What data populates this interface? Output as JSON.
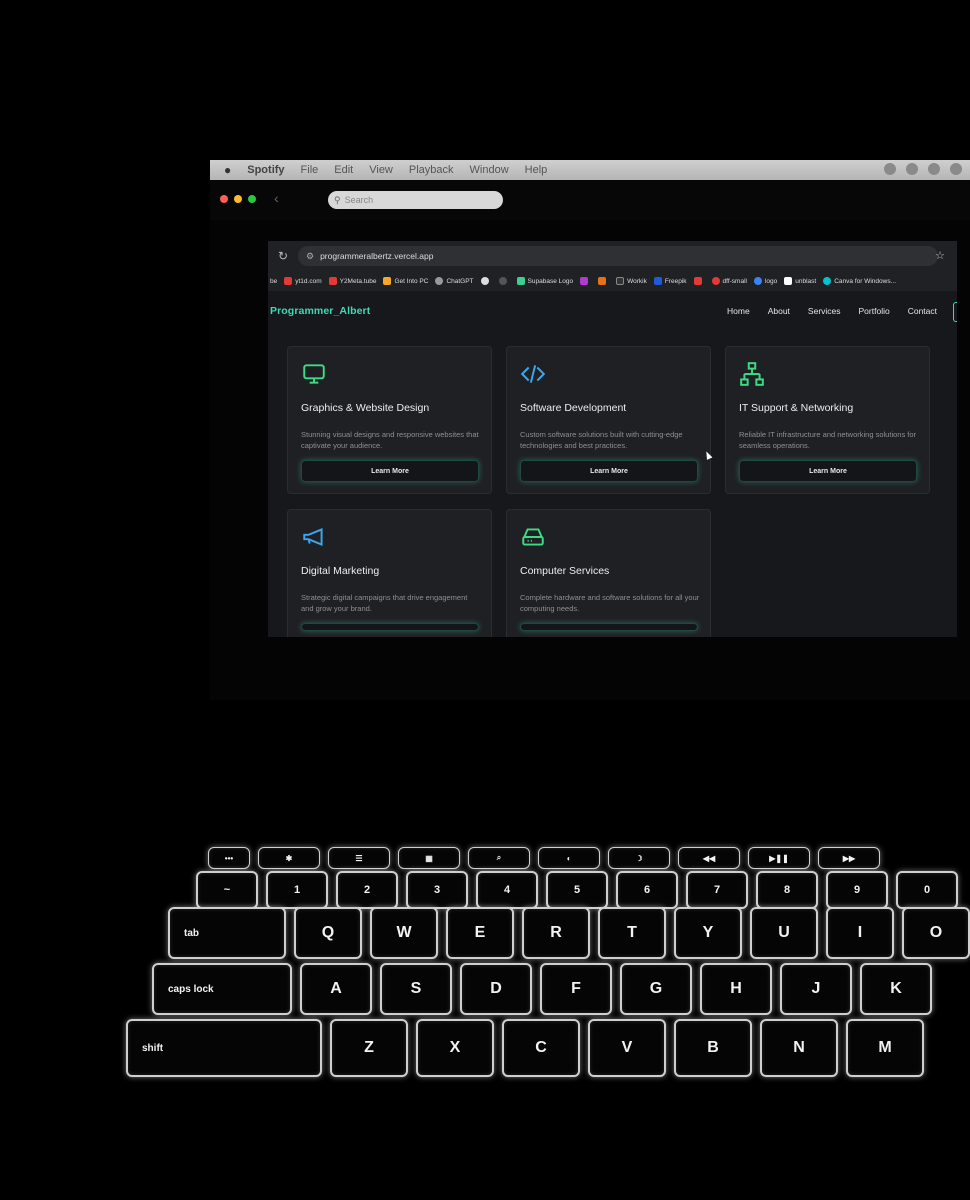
{
  "menubar": {
    "apple": "",
    "items": [
      "Spotify",
      "File",
      "Edit",
      "View",
      "Playback",
      "Window",
      "Help"
    ]
  },
  "spotify": {
    "search_placeholder": "Search",
    "back": "‹"
  },
  "browser": {
    "url": "programmeralbertz.vercel.app",
    "bookmarks": [
      "be",
      "yt1d.com",
      "Y2Meta.tube",
      "Get Into PC",
      "ChatGPT",
      "",
      "",
      "Supabase Logo",
      "",
      "",
      "Workik",
      "Freepik",
      "",
      "dff-small",
      "logo",
      "unblast",
      "Canva for Windows..."
    ]
  },
  "site": {
    "logo": "Programmer_Albert",
    "nav": [
      "Home",
      "About",
      "Services",
      "Portfolio",
      "Contact"
    ],
    "cards": [
      {
        "icon": "monitor-icon",
        "title": "Graphics & Website Design",
        "desc": "Stunning visual designs and responsive websites that captivate your audience.",
        "button": "Learn More",
        "color": "#3ddc84"
      },
      {
        "icon": "code-icon",
        "title": "Software Development",
        "desc": "Custom software solutions built with cutting-edge technologies and best practices.",
        "button": "Learn More",
        "color": "#3aa7f0"
      },
      {
        "icon": "network-icon",
        "title": "IT Support & Networking",
        "desc": "Reliable IT infrastructure and networking solutions for seamless operations.",
        "button": "Learn More",
        "color": "#3ddc84"
      },
      {
        "icon": "megaphone-icon",
        "title": "Digital Marketing",
        "desc": "Strategic digital campaigns that drive engagement and grow your brand.",
        "button": "",
        "color": "#3aa7f0"
      },
      {
        "icon": "hard-drive-icon",
        "title": "Computer Services",
        "desc": "Complete hardware and software solutions for all your computing needs.",
        "button": "",
        "color": "#3ddc84"
      }
    ]
  },
  "colors": {
    "accent": "#3fd9b4",
    "card_bg": "#1f2024",
    "page_bg": "#17181b"
  },
  "keyboard": {
    "row_fn": [
      "",
      "",
      "",
      "",
      "",
      "",
      "",
      "",
      "",
      "",
      ""
    ],
    "row_num": [
      "~",
      "!\n1",
      "@\n2",
      "#\n3",
      "$\n4",
      "%\n5",
      "^\n6",
      "&\n7",
      "*\n8",
      "(\n9",
      ")\n0"
    ],
    "row_q": [
      "tab",
      "Q",
      "W",
      "E",
      "R",
      "T",
      "Y",
      "U",
      "I",
      "O"
    ],
    "row_a": [
      "caps lock",
      "A",
      "S",
      "D",
      "F",
      "G",
      "H",
      "J",
      "K"
    ],
    "row_z": [
      "shift",
      "Z",
      "X",
      "C",
      "V",
      "B",
      "N",
      "M"
    ]
  }
}
